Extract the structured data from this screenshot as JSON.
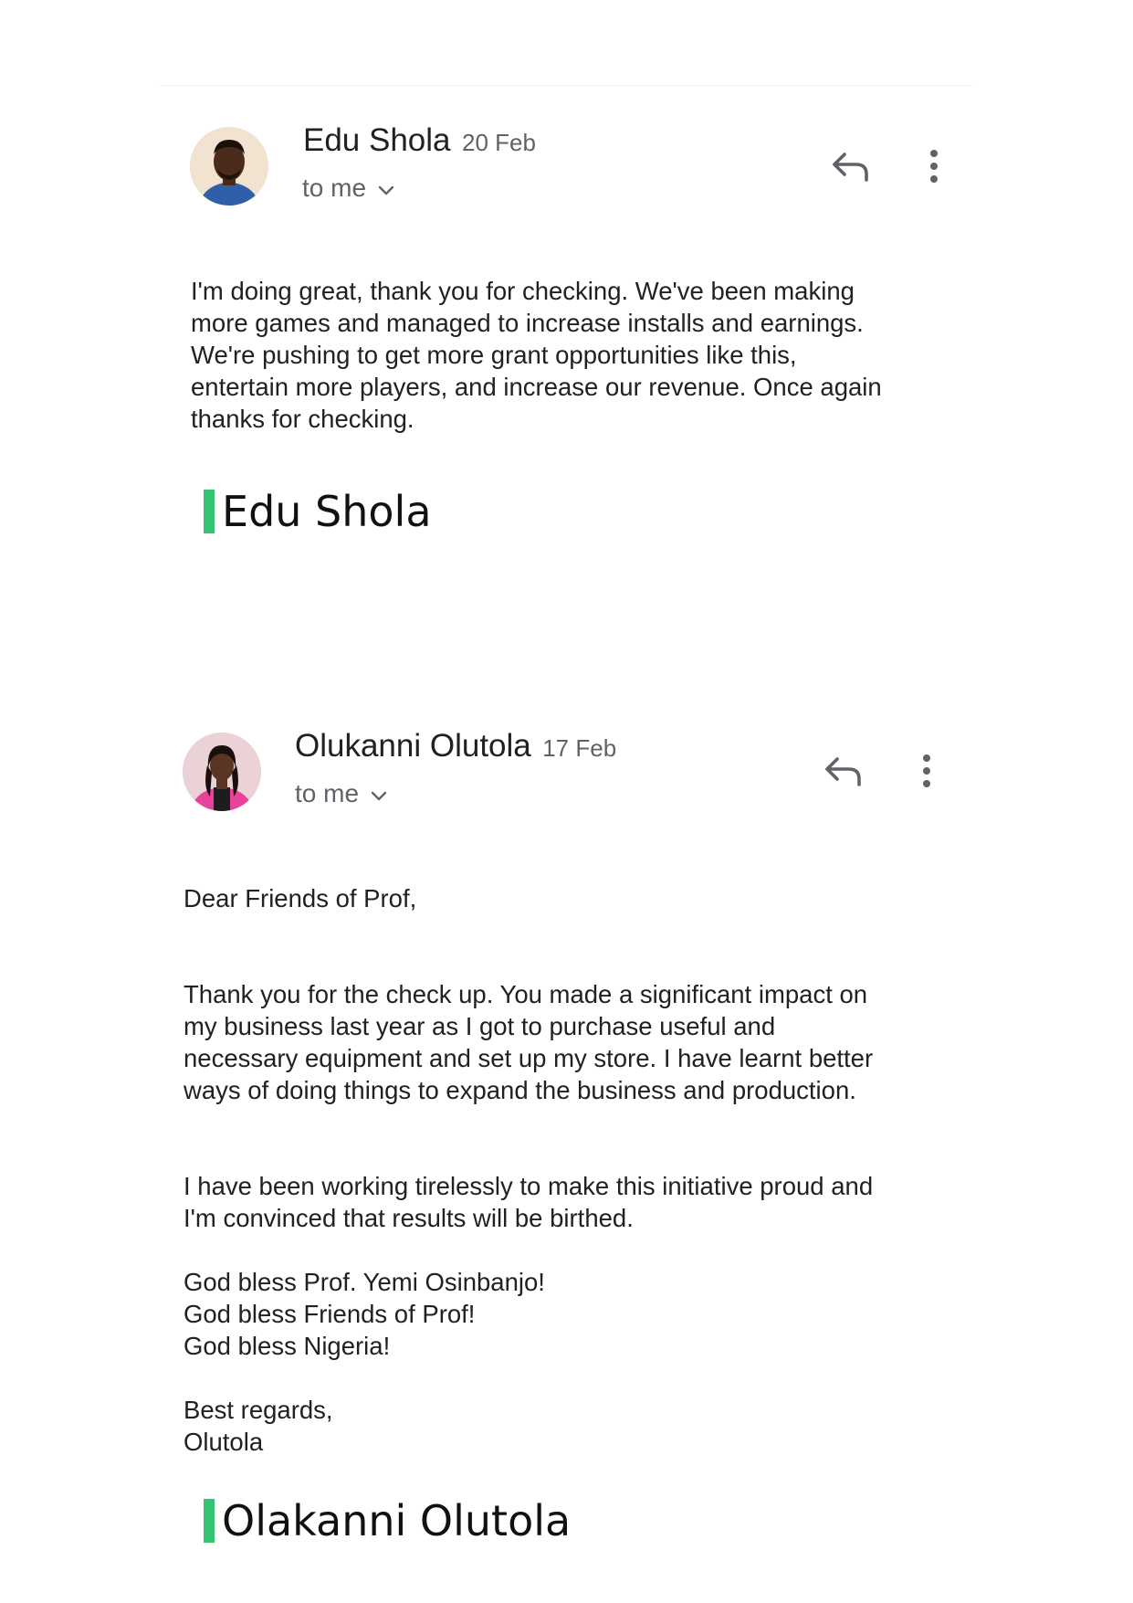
{
  "emails": [
    {
      "sender": "Edu Shola",
      "date": "20 Feb",
      "to": "to me",
      "body": [
        "I'm doing great, thank you for checking. We've been making\nmore games and managed to increase installs and earnings.\nWe're pushing to get more grant opportunities like this,\nentertain more players, and increase our revenue. Once again\nthanks for checking."
      ],
      "signature": "Edu Shola"
    },
    {
      "sender": "Olukanni Olutola",
      "date": "17 Feb",
      "to": "to me",
      "body": [
        "Dear Friends of Prof,",
        "Thank you for the check up. You made a significant impact on\nmy business last year as I got to purchase useful and\nnecessary equipment and set up my store. I have learnt better\nways of doing things to expand the business and production.",
        "I have been working tirelessly to make this initiative proud and\nI'm convinced that results will be birthed.",
        "God bless Prof. Yemi Osinbanjo!\nGod bless Friends of Prof!\nGod bless Nigeria!",
        "Best regards,\nOlutola"
      ],
      "signature": "Olakanni Olutola"
    }
  ],
  "colors": {
    "signature_accent": "#34c273",
    "secondary_text": "#5f6368",
    "primary_text": "#202124"
  },
  "icons": {
    "reply": "reply-icon",
    "more": "more-vert-icon",
    "expand": "chevron-down-icon"
  }
}
